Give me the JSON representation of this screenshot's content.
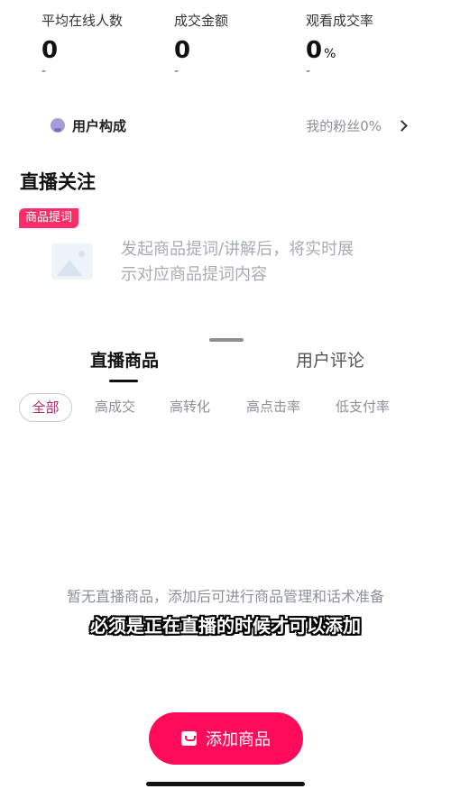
{
  "stats": [
    {
      "label": "平均在线人数",
      "value": "0",
      "unit": "",
      "delta": "-"
    },
    {
      "label": "成交金额",
      "value": "0",
      "unit": "",
      "delta": "-"
    },
    {
      "label": "观看成交率",
      "value": "0",
      "unit": "%",
      "delta": "-"
    }
  ],
  "audience": {
    "title": "用户构成",
    "fans": "我的粉丝0%"
  },
  "section_title": "直播关注",
  "prompt": {
    "tag": "商品提词",
    "text": "发起商品提词/讲解后，将实时展示对应商品提词内容"
  },
  "tabs": {
    "products": "直播商品",
    "comments": "用户评论"
  },
  "filters": [
    "全部",
    "高成交",
    "高转化",
    "高点击率",
    "低支付率"
  ],
  "empty_text": "暂无直播商品，添加后可进行商品管理和话术准备",
  "subtitle": "必须是正在直播的时候才可以添加",
  "add_button": "添加商品"
}
